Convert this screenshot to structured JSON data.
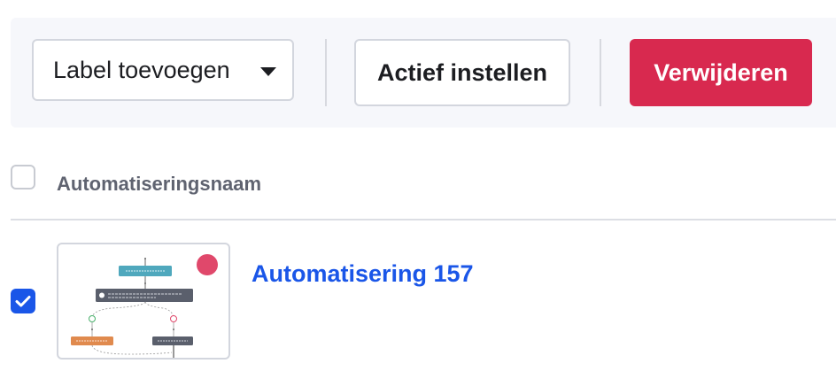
{
  "toolbar": {
    "label_select": {
      "value": "Label toevoegen",
      "icon": "chevron-down-icon"
    },
    "activate_label": "Actief instellen",
    "delete_label": "Verwijderen"
  },
  "table": {
    "column_header": "Automatiseringsnaam",
    "rows": [
      {
        "name": "Automatisering 157",
        "selected": true,
        "status_color": "#e0486b"
      }
    ]
  },
  "colors": {
    "accent": "#1a56e8",
    "danger": "#d8294f",
    "toolbar_bg": "#f6f7fb"
  }
}
